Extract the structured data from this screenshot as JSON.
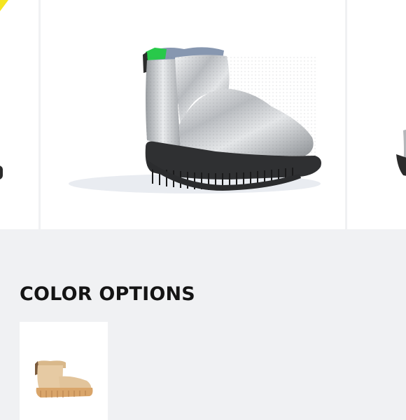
{
  "gallery": {
    "images": [
      {
        "icon": "boot-image-previous",
        "color": "#c9cbcd"
      },
      {
        "icon": "silver-metallic-boot-image",
        "color": "#c7c9cc"
      },
      {
        "icon": "boot-image-next",
        "color": "#c9cbcd"
      }
    ],
    "accent_color": "#f5e51f"
  },
  "color_options": {
    "title": "COLOR OPTIONS",
    "swatches": [
      {
        "icon": "tan-boot-thumbnail",
        "color": "#e6caa3"
      }
    ]
  }
}
